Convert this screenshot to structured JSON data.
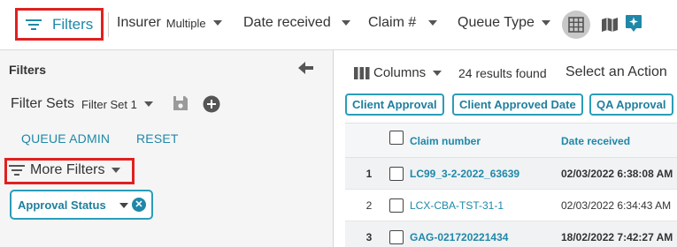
{
  "toolbar": {
    "filters_label": "Filters",
    "items": [
      {
        "label": "Insurer",
        "sub": "Multiple"
      },
      {
        "label": "Date received",
        "sub": ""
      },
      {
        "label": "Claim #",
        "sub": ""
      },
      {
        "label": "Queue Type",
        "sub": ""
      }
    ],
    "icons": [
      "filter-icon",
      "grid-icon",
      "map-icon",
      "ai-assistant-icon"
    ]
  },
  "left_panel": {
    "title": "Filters",
    "filter_sets_label": "Filter Sets",
    "filter_set_value": "Filter Set 1",
    "queue_admin": "QUEUE ADMIN",
    "reset": "RESET",
    "more_filters": "More Filters",
    "chip_label": "Approval Status"
  },
  "right_panel": {
    "columns_label": "Columns",
    "results": "24 results found",
    "select_action": "Select an Action",
    "tags": [
      "Client Approval",
      "Client Approved Date",
      "QA Approval"
    ],
    "table": {
      "headers": [
        "Claim number",
        "Date received"
      ],
      "rows": [
        {
          "num": "1",
          "claim": "LC99_3-2-2022_63639",
          "date": "02/03/2022 6:38:08 AM",
          "bold": true
        },
        {
          "num": "2",
          "claim": "LCX-CBA-TST-31-1",
          "date": "02/03/2022 6:34:43 AM",
          "bold": false
        },
        {
          "num": "3",
          "claim": "GAG-021720221434",
          "date": "18/02/2022 7:42:27 AM",
          "bold": true
        }
      ]
    }
  },
  "colors": {
    "accent": "#1f88a8",
    "highlight": "#e02020",
    "chip_border": "#2a9dba"
  }
}
